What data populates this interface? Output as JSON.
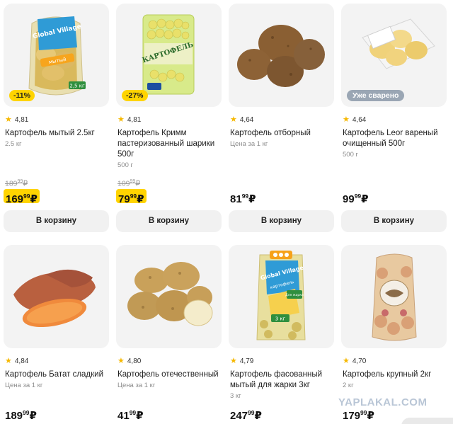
{
  "products": [
    {
      "name": "Картофель мытый 2.5кг",
      "weight": "2.5 кг",
      "rating": "4,81",
      "badge": "-11%",
      "old_price_int": "189",
      "old_price_dec": "99",
      "price_int": "169",
      "price_dec": "99",
      "currency": "₽",
      "button": "В корзину"
    },
    {
      "name": "Картофель Кримм пастеризованный шарики 500г",
      "weight": "500 г",
      "rating": "4,81",
      "badge": "-27%",
      "old_price_int": "109",
      "old_price_dec": "99",
      "price_int": "79",
      "price_dec": "99",
      "currency": "₽",
      "button": "В корзину"
    },
    {
      "name": "Картофель отборный",
      "weight": "Цена за 1 кг",
      "rating": "4,64",
      "price_int": "81",
      "price_dec": "99",
      "currency": "₽",
      "button": "В корзину"
    },
    {
      "name": "Картофель Leor вареный очищенный 500г",
      "weight": "500 г",
      "rating": "4,64",
      "badge": "Уже сварено",
      "price_int": "99",
      "price_dec": "99",
      "currency": "₽",
      "button": "В корзину"
    },
    {
      "name": "Картофель Батат сладкий",
      "weight": "Цена за 1 кг",
      "rating": "4,84",
      "price_int": "189",
      "price_dec": "99",
      "currency": "₽"
    },
    {
      "name": "Картофель отечественный",
      "weight": "Цена за 1 кг",
      "rating": "4,80",
      "price_int": "41",
      "price_dec": "99",
      "currency": "₽"
    },
    {
      "name": "Картофель фасованный мытый для жарки 3кг",
      "weight": "3 кг",
      "rating": "4,79",
      "price_int": "247",
      "price_dec": "99",
      "currency": "₽"
    },
    {
      "name": "Картофель крупный 2кг",
      "weight": "2 кг",
      "rating": "4,70",
      "price_int": "179",
      "price_dec": "99",
      "currency": "₽"
    }
  ],
  "package_text": {
    "global_village": "Global Village",
    "kartofel": "картофель",
    "mytyi": "мытый",
    "pack1_weight": "2,5 кг",
    "pack2_title": "КАРТОФЕЛЬ",
    "pack7_fry": "Для жарки",
    "pack7_weight": "3 кг"
  },
  "watermark": "YAPLAKAL.COM",
  "icons": {
    "rating": "star-icon"
  }
}
